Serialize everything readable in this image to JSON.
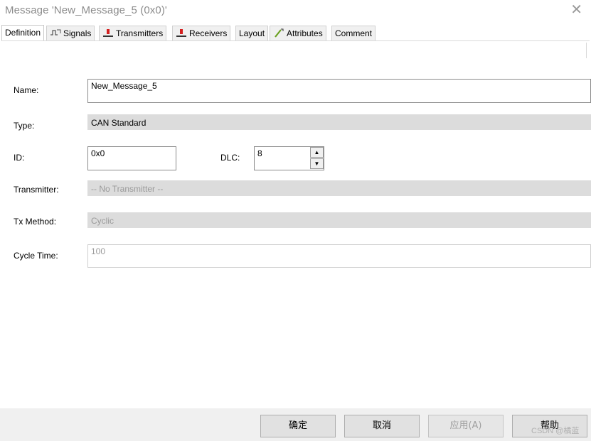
{
  "window": {
    "title": "Message 'New_Message_5 (0x0)'",
    "close_glyph": "✕"
  },
  "tabs": [
    {
      "label": "Definition",
      "icon": ""
    },
    {
      "label": "Signals",
      "icon": "signals-icon"
    },
    {
      "label": "Transmitters",
      "icon": "transmitter-icon"
    },
    {
      "label": "Receivers",
      "icon": "receiver-icon"
    },
    {
      "label": "Layout",
      "icon": ""
    },
    {
      "label": "Attributes",
      "icon": "attributes-icon"
    },
    {
      "label": "Comment",
      "icon": ""
    }
  ],
  "form": {
    "name_label": "Name:",
    "name_value": "New_Message_5",
    "type_label": "Type:",
    "type_value": "CAN Standard",
    "id_label": "ID:",
    "id_value": "0x0",
    "dlc_label": "DLC:",
    "dlc_value": "8",
    "transmitter_label": "Transmitter:",
    "transmitter_value": "-- No Transmitter --",
    "txmethod_label": "Tx Method:",
    "txmethod_value": "Cyclic",
    "cycletime_label": "Cycle Time:",
    "cycletime_value": "100"
  },
  "buttons": {
    "ok": "确定",
    "cancel": "取消",
    "apply": "应用(A)",
    "help": "帮助"
  },
  "watermark": "CSDN @橘蓝",
  "colors": {
    "readonly_bg": "#dcdcdc",
    "transmitter_red": "#d42020"
  }
}
